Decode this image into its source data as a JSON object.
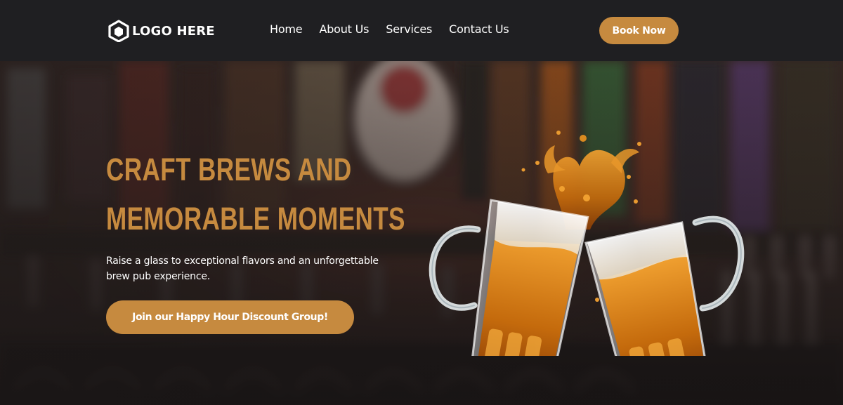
{
  "header": {
    "logo_text": "LOGO HERE",
    "nav": [
      "Home",
      "About Us",
      "Services",
      "Contact Us"
    ],
    "book_label": "Book Now"
  },
  "hero": {
    "headline_line1": "CRAFT BREWS AND",
    "headline_line2": "MEMORABLE MOMENTS",
    "subtext_line1": "Raise a glass to exceptional flavors and an unforgettable",
    "subtext_line2": "brew pub experience.",
    "cta_label": "Join our Happy Hour Discount Group!"
  },
  "colors": {
    "accent": "#c68a3f",
    "header_bg": "#1f1f22",
    "text": "#ffffff"
  },
  "icons": {
    "logo": "hexagon-logo-icon"
  }
}
